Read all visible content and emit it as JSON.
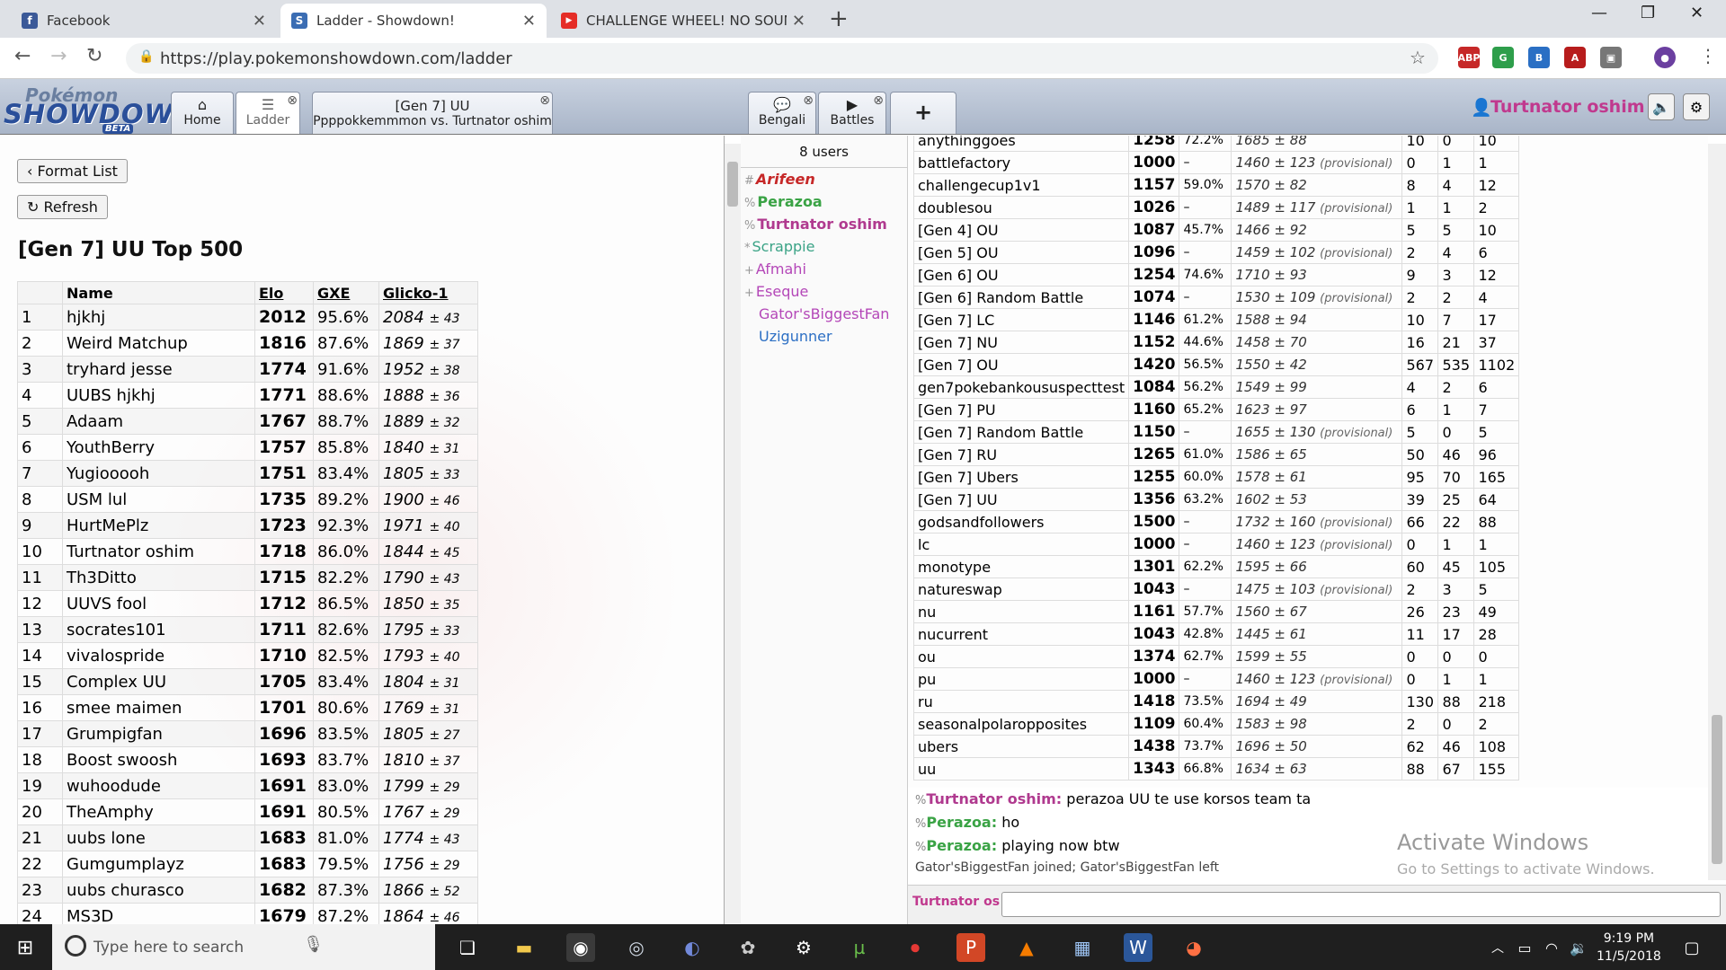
{
  "browser": {
    "tabs": [
      {
        "title": "Facebook",
        "icon": "facebook-icon",
        "color": "#3b5998",
        "glyph": "f"
      },
      {
        "title": "Ladder - Showdown!",
        "icon": "showdown-icon",
        "color": "#3b6db3",
        "glyph": "S"
      },
      {
        "title": "CHALLENGE WHEEL! NO SOUND",
        "icon": "youtube-icon",
        "color": "#e52d27",
        "glyph": "▶"
      }
    ],
    "url": "https://play.pokemonshowdown.com/ladder"
  },
  "header": {
    "logo_top": "Pokémon",
    "logo_main": "SHOWDOWN",
    "logo_beta": "BETA",
    "tabs": [
      {
        "label": "Home"
      },
      {
        "label": "Ladder"
      },
      {
        "title": "[Gen 7] UU",
        "subtitle": "Ppppokkemmmon vs. Turtnator oshim"
      },
      {
        "label": "Bengali"
      },
      {
        "label": "Battles"
      },
      {
        "label": "+"
      }
    ],
    "username": "Turtnator oshim"
  },
  "ladder": {
    "format_list_label": "Format List",
    "refresh_label": "Refresh",
    "title": "[Gen 7] UU Top 500",
    "columns": [
      "",
      "Name",
      "Elo",
      "GXE",
      "Glicko-1"
    ],
    "rows": [
      [
        "1",
        "hjkhj",
        "2012",
        "95.6%",
        "2084",
        "± 43"
      ],
      [
        "2",
        "Weird Matchup",
        "1816",
        "87.6%",
        "1869",
        "± 37"
      ],
      [
        "3",
        "tryhard jesse",
        "1774",
        "91.6%",
        "1952",
        "± 38"
      ],
      [
        "4",
        "UUBS hjkhj",
        "1771",
        "88.6%",
        "1888",
        "± 36"
      ],
      [
        "5",
        "Adaam",
        "1767",
        "88.7%",
        "1889",
        "± 32"
      ],
      [
        "6",
        "YouthBerry",
        "1757",
        "85.8%",
        "1840",
        "± 31"
      ],
      [
        "7",
        "Yugiooooh",
        "1751",
        "83.4%",
        "1805",
        "± 33"
      ],
      [
        "8",
        "USM lul",
        "1735",
        "89.2%",
        "1900",
        "± 46"
      ],
      [
        "9",
        "HurtMePlz",
        "1723",
        "92.3%",
        "1971",
        "± 40"
      ],
      [
        "10",
        "Turtnator oshim",
        "1718",
        "86.0%",
        "1844",
        "± 45"
      ],
      [
        "11",
        "Th3Ditto",
        "1715",
        "82.2%",
        "1790",
        "± 43"
      ],
      [
        "12",
        "UUVS fool",
        "1712",
        "86.5%",
        "1850",
        "± 35"
      ],
      [
        "13",
        "socrates101",
        "1711",
        "82.6%",
        "1795",
        "± 33"
      ],
      [
        "14",
        "vivalospride",
        "1710",
        "82.5%",
        "1793",
        "± 40"
      ],
      [
        "15",
        "Complex UU",
        "1705",
        "83.4%",
        "1804",
        "± 31"
      ],
      [
        "16",
        "smee maimen",
        "1701",
        "80.6%",
        "1769",
        "± 31"
      ],
      [
        "17",
        "Grumpigfan",
        "1696",
        "83.5%",
        "1805",
        "± 27"
      ],
      [
        "18",
        "Boost swoosh",
        "1693",
        "83.7%",
        "1810",
        "± 37"
      ],
      [
        "19",
        "wuhoodude",
        "1691",
        "83.0%",
        "1799",
        "± 29"
      ],
      [
        "20",
        "TheAmphy",
        "1691",
        "80.5%",
        "1767",
        "± 29"
      ],
      [
        "21",
        "uubs lone",
        "1683",
        "81.0%",
        "1774",
        "± 43"
      ],
      [
        "22",
        "Gumgumplayz",
        "1683",
        "79.5%",
        "1756",
        "± 29"
      ],
      [
        "23",
        "uubs churasco",
        "1682",
        "87.3%",
        "1866",
        "± 52"
      ],
      [
        "24",
        "MS3D",
        "1679",
        "87.2%",
        "1864",
        "± 46"
      ]
    ]
  },
  "userlist": {
    "count": "8 users",
    "users": [
      {
        "rank": "#",
        "name": "Arifeen",
        "color": "#c62828",
        "style": "italic"
      },
      {
        "rank": "%",
        "name": "Perazoa",
        "color": "#3aa345",
        "style": "bold"
      },
      {
        "rank": "%",
        "name": "Turtnator oshim",
        "color": "#b03a8f",
        "style": "bold"
      },
      {
        "rank": "*",
        "name": "Scrappie",
        "color": "#3aa386",
        "style": "normal"
      },
      {
        "rank": "+",
        "name": "Afmahi",
        "color": "#b447b8",
        "style": "normal"
      },
      {
        "rank": "+",
        "name": "Eseque",
        "color": "#b447b8",
        "style": "normal"
      },
      {
        "rank": "",
        "name": "Gator'sBiggestFan",
        "color": "#b447b8",
        "style": "normal"
      },
      {
        "rank": "",
        "name": "Uzigunner",
        "color": "#2c6fc4",
        "style": "normal"
      }
    ]
  },
  "stats": {
    "rows": [
      [
        "anythinggoes",
        "1258",
        "72.2%",
        "1685 ± 88",
        "",
        "10",
        "0",
        "10"
      ],
      [
        "battlefactory",
        "1000",
        "–",
        "1460 ± 123",
        "(provisional)",
        "0",
        "1",
        "1"
      ],
      [
        "challengecup1v1",
        "1157",
        "59.0%",
        "1570 ± 82",
        "",
        "8",
        "4",
        "12"
      ],
      [
        "doublesou",
        "1026",
        "–",
        "1489 ± 117",
        "(provisional)",
        "1",
        "1",
        "2"
      ],
      [
        "[Gen 4] OU",
        "1087",
        "45.7%",
        "1466 ± 92",
        "",
        "5",
        "5",
        "10"
      ],
      [
        "[Gen 5] OU",
        "1096",
        "–",
        "1459 ± 102",
        "(provisional)",
        "2",
        "4",
        "6"
      ],
      [
        "[Gen 6] OU",
        "1254",
        "74.6%",
        "1710 ± 93",
        "",
        "9",
        "3",
        "12"
      ],
      [
        "[Gen 6] Random Battle",
        "1074",
        "–",
        "1530 ± 109",
        "(provisional)",
        "2",
        "2",
        "4"
      ],
      [
        "[Gen 7] LC",
        "1146",
        "61.2%",
        "1588 ± 94",
        "",
        "10",
        "7",
        "17"
      ],
      [
        "[Gen 7] NU",
        "1152",
        "44.6%",
        "1458 ± 70",
        "",
        "16",
        "21",
        "37"
      ],
      [
        "[Gen 7] OU",
        "1420",
        "56.5%",
        "1550 ± 42",
        "",
        "567",
        "535",
        "1102"
      ],
      [
        "gen7pokebankoususpecttest",
        "1084",
        "56.2%",
        "1549 ± 99",
        "",
        "4",
        "2",
        "6"
      ],
      [
        "[Gen 7] PU",
        "1160",
        "65.2%",
        "1623 ± 97",
        "",
        "6",
        "1",
        "7"
      ],
      [
        "[Gen 7] Random Battle",
        "1150",
        "–",
        "1655 ± 130",
        "(provisional)",
        "5",
        "0",
        "5"
      ],
      [
        "[Gen 7] RU",
        "1265",
        "61.0%",
        "1586 ± 65",
        "",
        "50",
        "46",
        "96"
      ],
      [
        "[Gen 7] Ubers",
        "1255",
        "60.0%",
        "1578 ± 61",
        "",
        "95",
        "70",
        "165"
      ],
      [
        "[Gen 7] UU",
        "1356",
        "63.2%",
        "1602 ± 53",
        "",
        "39",
        "25",
        "64"
      ],
      [
        "godsandfollowers",
        "1500",
        "–",
        "1732 ± 160",
        "(provisional)",
        "66",
        "22",
        "88"
      ],
      [
        "lc",
        "1000",
        "–",
        "1460 ± 123",
        "(provisional)",
        "0",
        "1",
        "1"
      ],
      [
        "monotype",
        "1301",
        "62.2%",
        "1595 ± 66",
        "",
        "60",
        "45",
        "105"
      ],
      [
        "natureswap",
        "1043",
        "–",
        "1475 ± 103",
        "(provisional)",
        "2",
        "3",
        "5"
      ],
      [
        "nu",
        "1161",
        "57.7%",
        "1560 ± 67",
        "",
        "26",
        "23",
        "49"
      ],
      [
        "nucurrent",
        "1043",
        "42.8%",
        "1445 ± 61",
        "",
        "11",
        "17",
        "28"
      ],
      [
        "ou",
        "1374",
        "62.7%",
        "1599 ± 55",
        "",
        "0",
        "0",
        "0"
      ],
      [
        "pu",
        "1000",
        "–",
        "1460 ± 123",
        "(provisional)",
        "0",
        "1",
        "1"
      ],
      [
        "ru",
        "1418",
        "73.5%",
        "1694 ± 49",
        "",
        "130",
        "88",
        "218"
      ],
      [
        "seasonalpolaropposites",
        "1109",
        "60.4%",
        "1583 ± 98",
        "",
        "2",
        "0",
        "2"
      ],
      [
        "ubers",
        "1438",
        "73.7%",
        "1696 ± 50",
        "",
        "62",
        "46",
        "108"
      ],
      [
        "uu",
        "1343",
        "66.8%",
        "1634 ± 63",
        "",
        "88",
        "67",
        "155"
      ]
    ]
  },
  "chat": {
    "messages": [
      {
        "rank": "%",
        "name": "Turtnator oshim:",
        "color": "#b03a8f",
        "text": "perazoa UU te use korsos team ta"
      },
      {
        "rank": "%",
        "name": "Perazoa:",
        "color": "#3aa345",
        "text": "ho"
      },
      {
        "rank": "%",
        "name": "Perazoa:",
        "color": "#3aa345",
        "text": "playing now btw"
      }
    ],
    "system": "Gator'sBiggestFan joined; Gator'sBiggestFan left",
    "input_name": "Turtnator os"
  },
  "watermark": {
    "title": "Activate Windows",
    "subtitle": "Go to Settings to activate Windows."
  },
  "taskbar": {
    "search_placeholder": "Type here to search",
    "time": "9:19 PM",
    "date": "11/5/2018"
  }
}
